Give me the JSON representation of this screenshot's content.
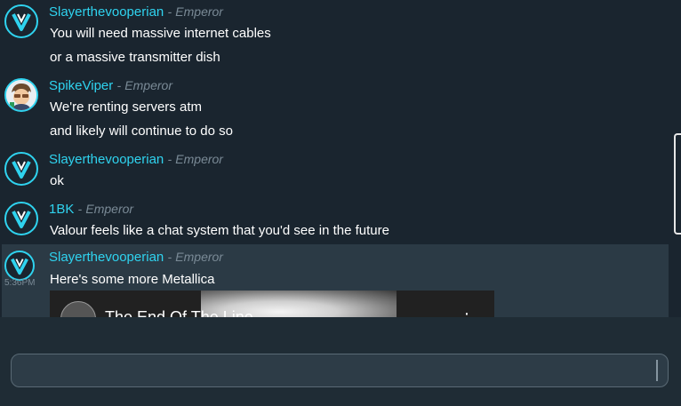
{
  "messages": [
    {
      "author": "Slayerthevooperian",
      "separator": "-",
      "role": "Emperor",
      "avatar": "valour-logo-icon",
      "lines": [
        "You will need massive internet cables",
        "or a massive transmitter dish"
      ]
    },
    {
      "author": "SpikeViper",
      "separator": "-",
      "role": "Emperor",
      "avatar": "spikeviper-avatar",
      "lines": [
        "We're renting servers atm",
        "and likely will continue to do so"
      ]
    },
    {
      "author": "Slayerthevooperian",
      "separator": "-",
      "role": "Emperor",
      "avatar": "valour-logo-icon",
      "lines": [
        "ok"
      ]
    },
    {
      "author": "1BK",
      "separator": "-",
      "role": "Emperor",
      "avatar": "valour-logo-icon",
      "lines": [
        "Valour feels like a chat system that you'd see in the future"
      ]
    },
    {
      "author": "Slayerthevooperian",
      "separator": "-",
      "role": "Emperor",
      "avatar": "valour-logo-icon",
      "time": "5:36PM",
      "lines": [
        "Here's some more Metallica"
      ],
      "embed": {
        "title": "The End Of The Line",
        "menu_icon": "more-vertical-icon"
      }
    }
  ],
  "input": {
    "value": "",
    "placeholder": ""
  },
  "colors": {
    "accent": "#2fd3ef",
    "background": "#1a252f",
    "hover": "#2b3a45"
  }
}
